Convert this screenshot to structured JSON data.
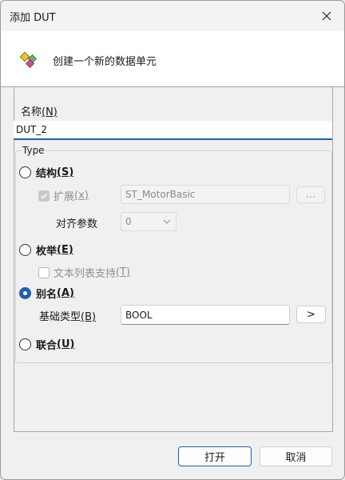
{
  "window": {
    "title": "添加 DUT",
    "close_icon": "close-icon"
  },
  "header": {
    "icon": "dut-icon",
    "text": "创建一个新的数据单元"
  },
  "name": {
    "label": "名称",
    "mnemonic": "(N)",
    "value": "DUT_2"
  },
  "type_group": {
    "legend": "Type",
    "structure": {
      "label": "结构",
      "mnemonic": "(S)",
      "selected": false,
      "extends_label": "扩展",
      "extends_mnemonic": "(x)",
      "extends_checked": true,
      "extends_value": "ST_MotorBasic",
      "browse_label": "...",
      "alignment_label": "对齐参数",
      "alignment_value": "0"
    },
    "enumeration": {
      "label": "枚举",
      "mnemonic": "(E)",
      "selected": false,
      "textlist_label": "文本列表支持",
      "textlist_mnemonic": "(T)",
      "textlist_checked": false
    },
    "alias": {
      "label": "别名",
      "mnemonic": "(A)",
      "selected": true,
      "base_type_label": "基础类型",
      "base_type_mnemonic": "(B)",
      "base_type_value": "BOOL",
      "base_type_button": ">"
    },
    "union": {
      "label": "联合",
      "mnemonic": "(U)",
      "selected": false
    }
  },
  "footer": {
    "open_button": "打开",
    "cancel_button": "取消"
  },
  "colors": {
    "accent": "#1d5fb5",
    "window_bg": "#f0f0f0",
    "header_bg": "#ffffff"
  }
}
